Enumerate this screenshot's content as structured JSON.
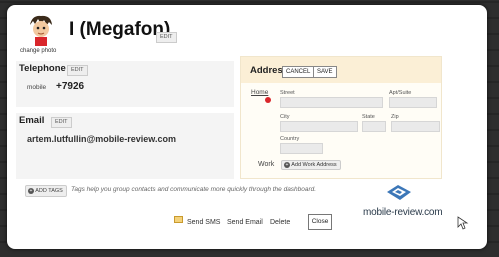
{
  "contact": {
    "name": "I (Megafon)",
    "edit_label": "EDIT",
    "change_photo": "change photo"
  },
  "telephone": {
    "title": "Telephone",
    "edit_label": "EDIT",
    "type": "mobile",
    "number": "+7926"
  },
  "email": {
    "title": "Email",
    "edit_label": "EDIT",
    "value": "artem.lutfullin@mobile-review.com"
  },
  "address": {
    "title": "Address",
    "cancel_label": "CANCEL",
    "save_label": "SAVE",
    "home_label": "Home",
    "fields": {
      "street": "Street",
      "apt": "Apt/Suite",
      "city": "City",
      "state": "State",
      "zip": "Zip",
      "country": "Country"
    },
    "work_label": "Work",
    "add_work_label": "Add Work Address"
  },
  "tags": {
    "button_label": "ADD TAGS",
    "help_text": "Tags help you group contacts and communicate more quickly through the dashboard."
  },
  "actions": {
    "send_sms": "Send SMS",
    "send_email": "Send Email",
    "delete": "Delete",
    "close": "Close"
  },
  "watermark": {
    "text": "mobile-review.com"
  },
  "colors": {
    "address_header": "#fbefd6",
    "home_marker": "#d9262b",
    "logo_blue": "#3c77b8"
  }
}
